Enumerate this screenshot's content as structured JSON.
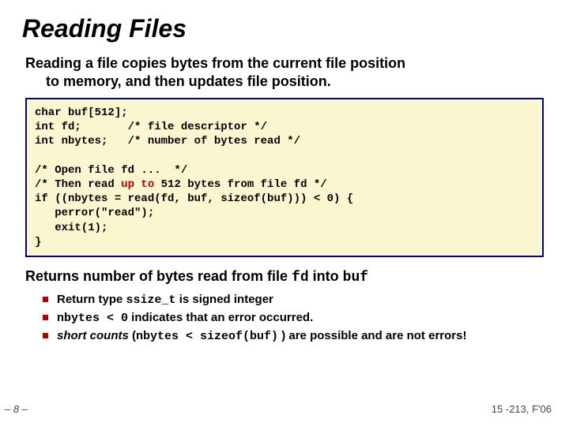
{
  "title": "Reading Files",
  "subtitle_line1": "Reading a file copies bytes from the current file position",
  "subtitle_line2": "to memory, and then updates file position.",
  "code": {
    "l1": "char buf[512];",
    "l2": "int fd;       /* file descriptor */",
    "l3": "int nbytes;   /* number of bytes read */",
    "l4": "",
    "l5": "/* Open file fd ...  */",
    "l6a": "/* Then read ",
    "l6em": "up to",
    "l6b": " 512 bytes from file fd */",
    "l7": "if ((nbytes = read(fd, buf, sizeof(buf))) < 0) {",
    "l8": "   perror(\"read\");",
    "l9": "   exit(1);",
    "l10": "}"
  },
  "returns": {
    "a": "Returns number of bytes read from file ",
    "fd": "fd",
    "b": " into ",
    "buf": "buf"
  },
  "bullets": {
    "b1a": "Return type ",
    "b1mono": "ssize_t",
    "b1b": " is signed integer",
    "b2mono": "nbytes < 0",
    "b2b": " indicates that an error occurred.",
    "b3em": "short counts",
    "b3a": " (",
    "b3mono": "nbytes < sizeof(buf)",
    "b3b": " ) are possible and are not errors!"
  },
  "pagenum": "– 8 –",
  "footer": "15 -213, F'06"
}
